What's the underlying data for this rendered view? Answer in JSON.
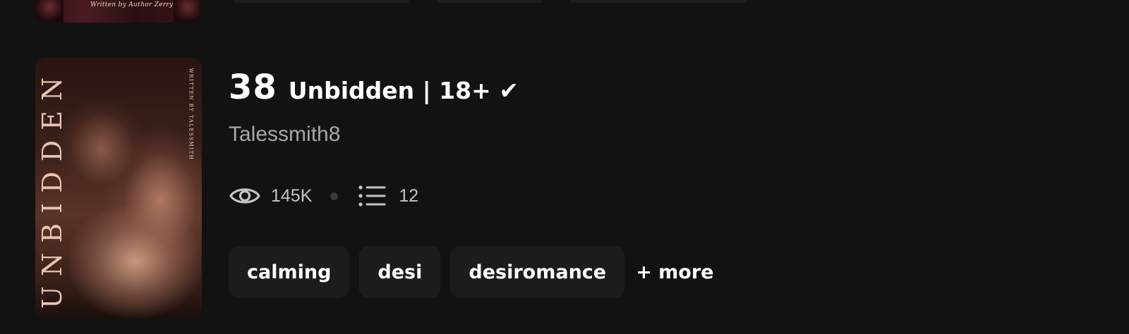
{
  "previous_story": {
    "cover_credit": "Written by Author Zerry"
  },
  "story": {
    "rank": "38",
    "title": "Unbidden | 18+ ✔",
    "author": "Talessmith8",
    "reads": "145K",
    "parts": "12",
    "cover": {
      "title_text": "UNBIDDEN",
      "credit_text": "WRITTEN BY TALESSMITH"
    },
    "tags": [
      "calming",
      "desi",
      "desiromance"
    ],
    "more_label": "+ more",
    "icons": {
      "reads": "eye-icon",
      "parts": "list-icon"
    }
  },
  "colors": {
    "background": "#121212",
    "tag_background": "#1c1c1c",
    "author_text": "#a8a8a8",
    "stat_text": "#c4c4c4"
  }
}
